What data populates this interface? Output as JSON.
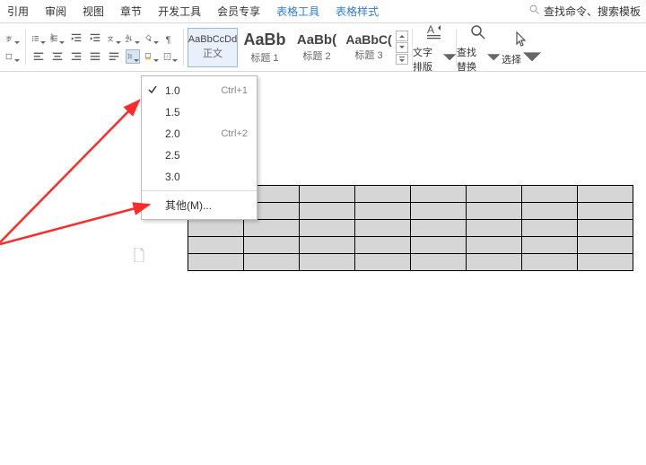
{
  "menubar": {
    "tabs": [
      "引用",
      "审阅",
      "视图",
      "章节",
      "开发工具",
      "会员专享"
    ],
    "context_tabs": [
      "表格工具",
      "表格样式"
    ],
    "search_placeholder": "查找命令、搜索模板"
  },
  "styles": [
    {
      "preview": "AaBbCcDd",
      "label": "正文",
      "big": false,
      "selected": true
    },
    {
      "preview": "AaBb",
      "label": "标题 1",
      "big": true,
      "selected": false
    },
    {
      "preview": "AaBb(",
      "label": "标题 2",
      "big": false,
      "selected": false
    },
    {
      "preview": "AaBbC(",
      "label": "标题 3",
      "big": false,
      "selected": false
    }
  ],
  "big_buttons": {
    "layout": "文字排版",
    "find": "查找替换",
    "select": "选择"
  },
  "line_spacing_menu": {
    "items": [
      {
        "label": "1.0",
        "shortcut": "Ctrl+1",
        "checked": true
      },
      {
        "label": "1.5",
        "shortcut": "",
        "checked": false
      },
      {
        "label": "2.0",
        "shortcut": "Ctrl+2",
        "checked": false
      },
      {
        "label": "2.5",
        "shortcut": "",
        "checked": false
      },
      {
        "label": "3.0",
        "shortcut": "",
        "checked": false
      }
    ],
    "more": "其他(M)..."
  },
  "table": {
    "rows": 5,
    "cols": 8
  }
}
